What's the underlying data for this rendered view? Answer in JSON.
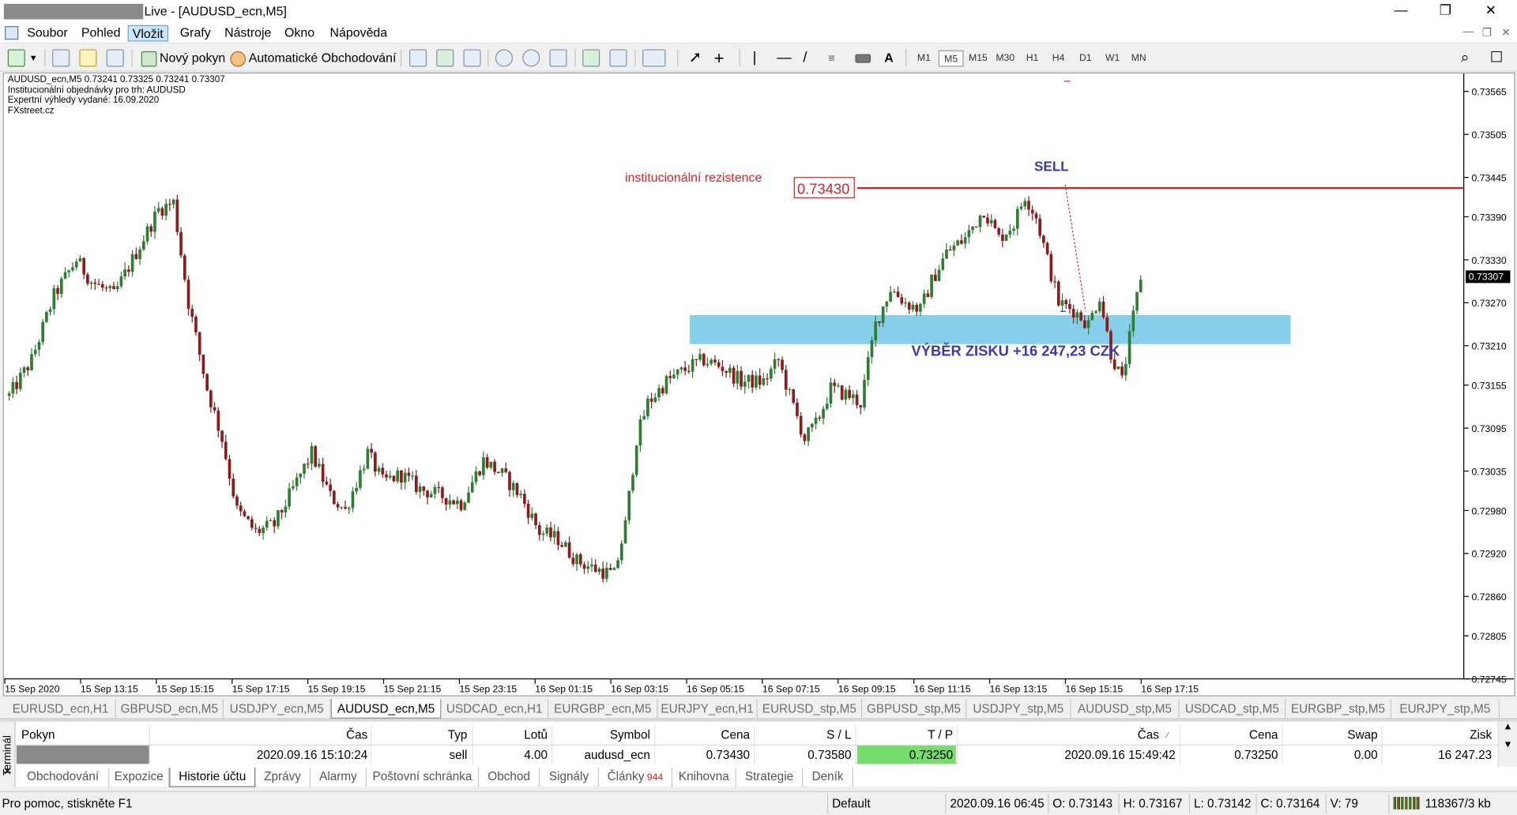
{
  "window": {
    "title": "Live - [AUDUSD_ecn,M5]",
    "controls": [
      "—",
      "❐",
      "✕"
    ]
  },
  "menu": {
    "items": [
      "Soubor",
      "Pohled",
      "Vložit",
      "Grafy",
      "Nástroje",
      "Okno",
      "Nápověda"
    ],
    "active_index": 2,
    "mdi_controls": [
      "—",
      "❐",
      "✕"
    ]
  },
  "toolbar": {
    "new_order": "Nový pokyn",
    "auto_trading": "Automatické Obchodování",
    "text_tool": "A",
    "timeframes": [
      "M1",
      "M5",
      "M15",
      "M30",
      "H1",
      "H4",
      "D1",
      "W1",
      "MN"
    ],
    "active_timeframe": "M5"
  },
  "chart": {
    "header_line": "AUDUSD_ecn,M5  0.73241 0.73325 0.73241 0.73307",
    "info_lines": [
      "Institucionální objednávky pro trh: AUDUSD",
      "Expertní výhledy vydané: 16.09.2020",
      "FXstreet.cz"
    ],
    "resistance_label": "institucionální rezistence",
    "resistance_price": "0.73430",
    "sell_label": "SELL",
    "profit_label": "VÝBĚR ZISKU +16 247,23 CZK",
    "current_price": "0.73307",
    "colors": {
      "bull": "#2e7d32",
      "bear": "#8b1c1c",
      "resistance": "#e02020",
      "zone": "#87ceeb",
      "annotation": "#3a3aa8"
    }
  },
  "chart_data": {
    "type": "candlestick",
    "symbol": "AUDUSD_ecn",
    "timeframe": "M5",
    "y_ticks": [
      "0.73565",
      "0.73505",
      "0.73445",
      "0.73390",
      "0.73330",
      "0.73270",
      "0.73210",
      "0.73155",
      "0.73095",
      "0.73035",
      "0.72980",
      "0.72920",
      "0.72860",
      "0.72805",
      "0.72745"
    ],
    "x_ticks": [
      "15 Sep 2020",
      "15 Sep 13:15",
      "15 Sep 15:15",
      "15 Sep 17:15",
      "15 Sep 19:15",
      "15 Sep 21:15",
      "15 Sep 23:15",
      "16 Sep 01:15",
      "16 Sep 03:15",
      "16 Sep 05:15",
      "16 Sep 07:15",
      "16 Sep 09:15",
      "16 Sep 11:15",
      "16 Sep 13:15",
      "16 Sep 15:15",
      "16 Sep 17:15"
    ],
    "ylim": [
      0.72745,
      0.7359
    ],
    "price_path": [
      [
        0,
        0.7314
      ],
      [
        6,
        0.7319
      ],
      [
        12,
        0.7328
      ],
      [
        18,
        0.7333
      ],
      [
        22,
        0.733
      ],
      [
        28,
        0.7328
      ],
      [
        34,
        0.7334
      ],
      [
        40,
        0.734
      ],
      [
        44,
        0.7341
      ],
      [
        48,
        0.7327
      ],
      [
        53,
        0.7315
      ],
      [
        57,
        0.7308
      ],
      [
        61,
        0.7298
      ],
      [
        66,
        0.7295
      ],
      [
        71,
        0.7296
      ],
      [
        77,
        0.7302
      ],
      [
        81,
        0.7306
      ],
      [
        86,
        0.73
      ],
      [
        90,
        0.7298
      ],
      [
        96,
        0.7306
      ],
      [
        100,
        0.7302
      ],
      [
        105,
        0.7303
      ],
      [
        110,
        0.7301
      ],
      [
        116,
        0.73
      ],
      [
        121,
        0.7299
      ],
      [
        127,
        0.7305
      ],
      [
        132,
        0.7303
      ],
      [
        137,
        0.73
      ],
      [
        142,
        0.7295
      ],
      [
        147,
        0.7294
      ],
      [
        152,
        0.7291
      ],
      [
        156,
        0.729
      ],
      [
        162,
        0.7289
      ],
      [
        165,
        0.7296
      ],
      [
        168,
        0.7308
      ],
      [
        171,
        0.7313
      ],
      [
        176,
        0.7316
      ],
      [
        182,
        0.7318
      ],
      [
        186,
        0.7319
      ],
      [
        191,
        0.7318
      ],
      [
        196,
        0.7316
      ],
      [
        202,
        0.7316
      ],
      [
        206,
        0.7319
      ],
      [
        209,
        0.7314
      ],
      [
        213,
        0.7308
      ],
      [
        216,
        0.731
      ],
      [
        220,
        0.7315
      ],
      [
        225,
        0.7314
      ],
      [
        228,
        0.7313
      ],
      [
        232,
        0.7324
      ],
      [
        236,
        0.7329
      ],
      [
        240,
        0.7327
      ],
      [
        244,
        0.7326
      ],
      [
        247,
        0.733
      ],
      [
        251,
        0.7334
      ],
      [
        256,
        0.7336
      ],
      [
        261,
        0.734
      ],
      [
        265,
        0.7336
      ],
      [
        269,
        0.7338
      ],
      [
        272,
        0.7342
      ],
      [
        275,
        0.7339
      ],
      [
        278,
        0.7333
      ],
      [
        281,
        0.7327
      ],
      [
        285,
        0.7326
      ],
      [
        289,
        0.7324
      ],
      [
        292,
        0.7328
      ],
      [
        295,
        0.732
      ],
      [
        298,
        0.7316
      ],
      [
        301,
        0.7325
      ],
      [
        303,
        0.73307
      ]
    ],
    "resistance": 0.7343,
    "zone": [
      0.7321,
      0.7325
    ]
  },
  "chart_tabs": [
    "EURUSD_ecn,H1",
    "GBPUSD_ecn,M5",
    "USDJPY_ecn,M5",
    "AUDUSD_ecn,M5",
    "USDCAD_ecn,H1",
    "EURGBP_ecn,M5",
    "EURJPY_ecn,H1",
    "EURUSD_stp,M5",
    "GBPUSD_stp,M5",
    "USDJPY_stp,M5",
    "AUDUSD_stp,M5",
    "USDCAD_stp,M5",
    "EURGBP_stp,M5",
    "EURJPY_stp,M5"
  ],
  "chart_tab_active": 3,
  "terminal": {
    "side_label": "Terminál",
    "close": "✕",
    "columns": [
      "Pokyn",
      "Čas",
      "Typ",
      "Lotů",
      "Symbol",
      "Cena",
      "S / L",
      "T / P",
      "Čas",
      "Cena",
      "Swap",
      "Zisk"
    ],
    "row": {
      "time_open": "2020.09.16 15:10:24",
      "type": "sell",
      "lots": "4.00",
      "symbol": "audusd_ecn",
      "price_open": "0.73430",
      "sl": "0.73580",
      "tp": "0.73250",
      "time_close": "2020.09.16 15:49:42",
      "price_close": "0.73250",
      "swap": "0.00",
      "profit": "16 247.23"
    },
    "tabs": [
      "Obchodování",
      "Expozice",
      "Historie účtu",
      "Zprávy",
      "Alarmy",
      "Poštovní schránka",
      "Obchod",
      "Signály",
      "Články",
      "Knihovna",
      "Strategie",
      "Deník"
    ],
    "articles_badge": "944",
    "active_tab": 2
  },
  "status": {
    "help": "Pro pomoc, stiskněte F1",
    "profile": "Default",
    "datetime": "2020.09.16 06:45",
    "open": "O: 0.73143",
    "high": "H: 0.73167",
    "low": "L: 0.73142",
    "close": "C: 0.73164",
    "volume": "V: 79",
    "traffic": "118367/3 kb"
  }
}
